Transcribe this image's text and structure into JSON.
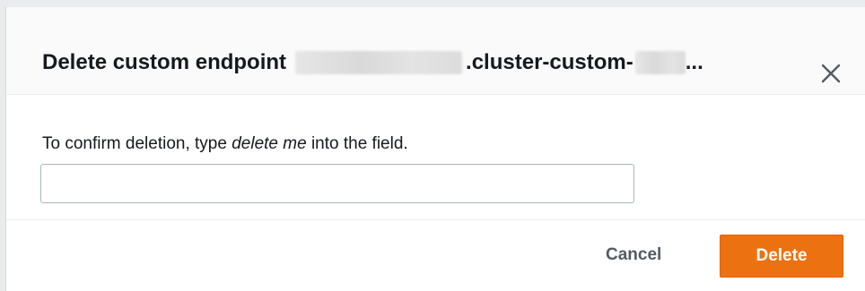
{
  "modal": {
    "title_prefix": "Delete custom endpoint",
    "title_middle": ".cluster-custom-",
    "title_suffix": "...",
    "close_icon": "close-icon",
    "instruction_prefix": "To confirm deletion, type ",
    "instruction_keyword": "delete me",
    "instruction_suffix": " into the field.",
    "input_value": "",
    "input_placeholder": "",
    "cancel_label": "Cancel",
    "delete_label": "Delete"
  },
  "colors": {
    "primary_button": "#ec7211",
    "text": "#16191f",
    "secondary_text": "#545b64"
  }
}
